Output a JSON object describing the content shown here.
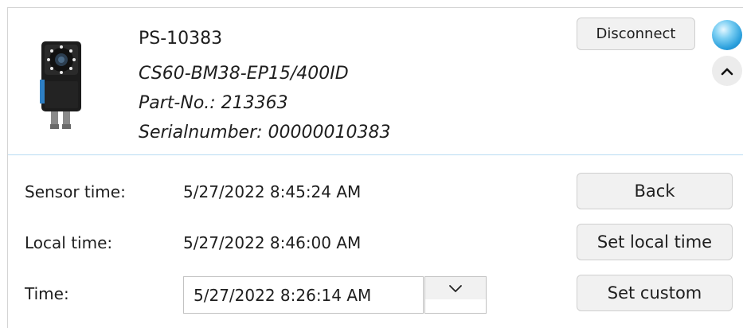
{
  "device": {
    "name": "PS-10383",
    "model": "CS60-BM38-EP15/400ID",
    "part_no": "Part-No.: 213363",
    "serial": "Serialnumber: 00000010383"
  },
  "header": {
    "disconnect_label": "Disconnect",
    "status_color": "#2a9fdc"
  },
  "icons": {
    "collapse": "chevron-up-icon",
    "dropdown": "chevron-down-icon"
  },
  "time_panel": {
    "sensor_label": "Sensor time:",
    "sensor_value": "5/27/2022 8:45:24 AM",
    "local_label": "Local time:",
    "local_value": "5/27/2022 8:46:00 AM",
    "custom_label": "Time:",
    "custom_value": "5/27/2022 8:26:14 AM"
  },
  "actions": {
    "back": "Back",
    "set_local": "Set local time",
    "set_custom": "Set custom"
  }
}
